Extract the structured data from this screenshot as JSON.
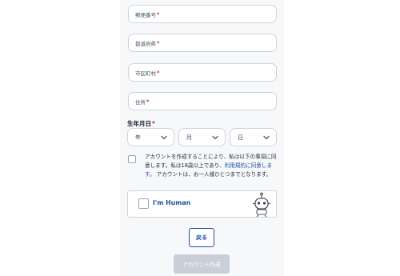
{
  "form": {
    "fields": [
      {
        "label": "郵便番号",
        "required_mark": "*"
      },
      {
        "label": "都道府県",
        "required_mark": "*"
      },
      {
        "label": "市区町村",
        "required_mark": "*"
      },
      {
        "label": "住所",
        "required_mark": "*"
      }
    ],
    "dob": {
      "label": "生年月日",
      "required_mark": "*",
      "year": "年",
      "month": "月",
      "day": "日"
    },
    "agreement": {
      "text_part1": "アカウントを作成することにより、私は以下の事項に同意します。私は18歳以上であり、",
      "link_text": "利用規約に同意します",
      "text_part2": "。 アカウントは、お一人様ひとつまでとなります。"
    },
    "captcha": {
      "label": "I'm Human"
    },
    "buttons": {
      "back": "戻る",
      "create": "アカウント作成"
    }
  },
  "colors": {
    "accent": "#1d4fa3",
    "required": "#c81e1e",
    "disabled_button": "#c9cfd9"
  }
}
